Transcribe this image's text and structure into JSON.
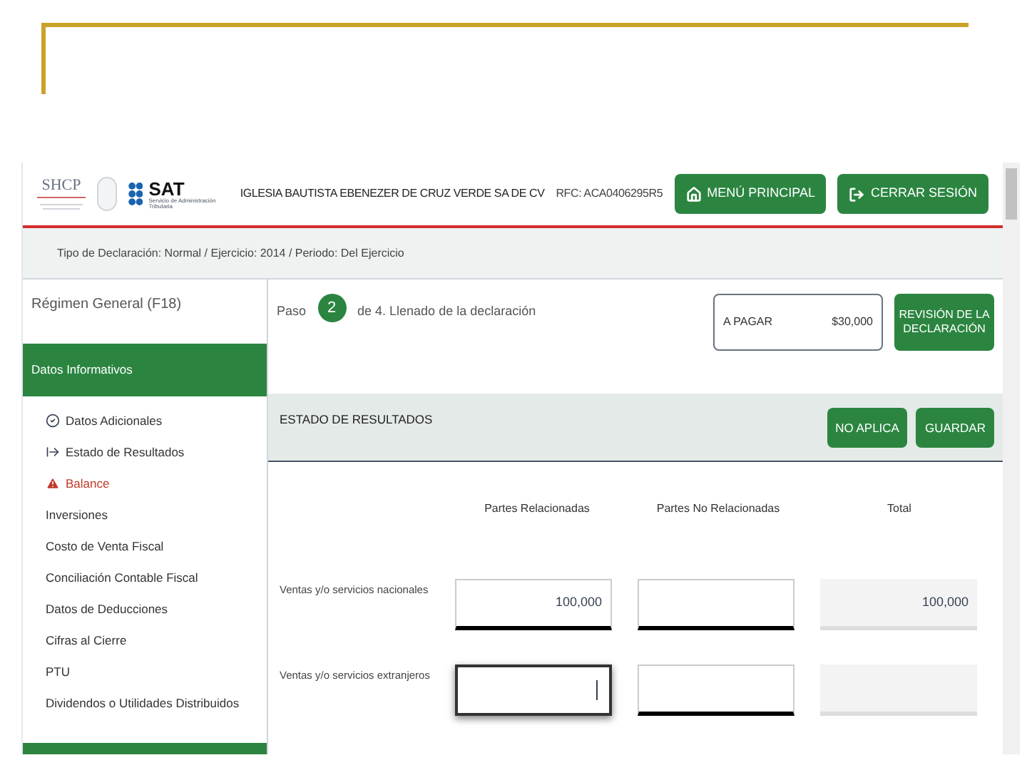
{
  "header": {
    "agency": "SHCP",
    "sat": "SAT",
    "sat_subtitle": "Servicio de Administración Tributaria",
    "taxpayer": "IGLESIA BAUTISTA EBENEZER DE CRUZ VERDE SA DE CV",
    "rfc": "RFC: ACA0406295R5",
    "buttons": [
      {
        "kind": "home",
        "label": "MENÚ PRINCIPAL"
      },
      {
        "kind": "logout",
        "label": "CERRAR SESIÓN"
      }
    ]
  },
  "breadcrumb": "Tipo de Declaración: Normal / Ejercicio: 2014 / Periodo: Del Ejercicio",
  "sidebar": {
    "regime": "Régimen General (F18)",
    "section": "Datos Informativos",
    "items": [
      {
        "label": "Datos Adicionales",
        "kind": "done"
      },
      {
        "label": "Estado de Resultados",
        "kind": "current"
      },
      {
        "label": "Balance",
        "kind": "warning"
      },
      {
        "label": "Inversiones",
        "kind": "plain"
      },
      {
        "label": "Costo de Venta Fiscal",
        "kind": "plain"
      },
      {
        "label": "Conciliación Contable Fiscal",
        "kind": "plain"
      },
      {
        "label": "Datos de Deducciones",
        "kind": "plain"
      },
      {
        "label": "Cifras al Cierre",
        "kind": "plain"
      },
      {
        "label": "PTU",
        "kind": "plain"
      },
      {
        "label": "Dividendos o Utilidades Distribuidos",
        "kind": "plain"
      }
    ]
  },
  "step": {
    "prefix": "Paso",
    "number": "2",
    "text": "de 4. Llenado de la declaración"
  },
  "summary": {
    "label": "A PAGAR",
    "amount": "$30,000",
    "button": "REVISIÓN DE LA DECLARACIÓN"
  },
  "section": {
    "title": "ESTADO DE RESULTADOS",
    "buttons": [
      "NO APLICA",
      "GUARDAR"
    ]
  },
  "columns": [
    "Partes Relacionadas",
    "Partes No Relacionadas",
    "Total"
  ],
  "rows": [
    {
      "label": "Ventas y/o servicios nacionales",
      "cells": [
        {
          "value": "100,000",
          "focused": false,
          "disabled": false
        },
        {
          "focused": false,
          "disabled": false
        },
        {
          "value": "100,000",
          "focused": false,
          "disabled": true
        }
      ]
    },
    {
      "label": "Ventas y/o servicios extranjeros",
      "cells": [
        {
          "focused": true,
          "disabled": false
        },
        {
          "focused": false,
          "disabled": false
        },
        {
          "focused": false,
          "disabled": true
        }
      ]
    }
  ]
}
